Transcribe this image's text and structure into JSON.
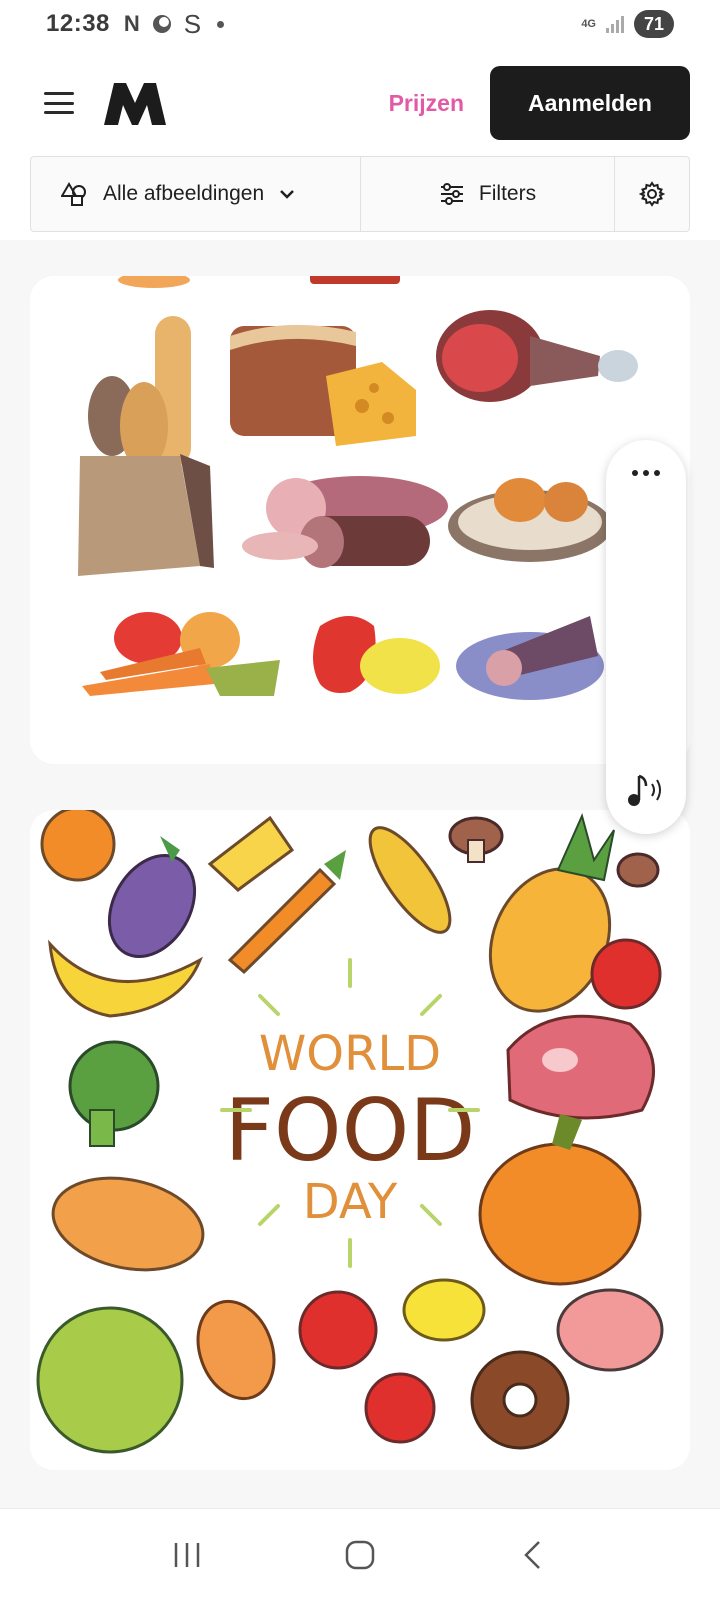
{
  "status_bar": {
    "time": "12:38",
    "notif_n": "N",
    "notif_s": "S",
    "network": "4G",
    "battery": "71"
  },
  "header": {
    "pricing_label": "Prijzen",
    "login_label": "Aanmelden",
    "logo_icon": "m-logo-icon",
    "menu_icon": "hamburger-menu-icon"
  },
  "filter_bar": {
    "type_label": "Alle afbeeldingen",
    "filters_label": "Filters",
    "type_icon": "shapes-icon",
    "filters_icon": "sliders-icon",
    "settings_icon": "gear-icon"
  },
  "results": {
    "image1_desc": "food-groceries-illustration",
    "image2_title_line1": "WORLD",
    "image2_title_line2": "FOOD",
    "image2_title_line3": "DAY"
  },
  "colors": {
    "accent_pink": "#e25aa6",
    "button_dark": "#1c1c1c",
    "page_bg": "#f7f7f7"
  }
}
